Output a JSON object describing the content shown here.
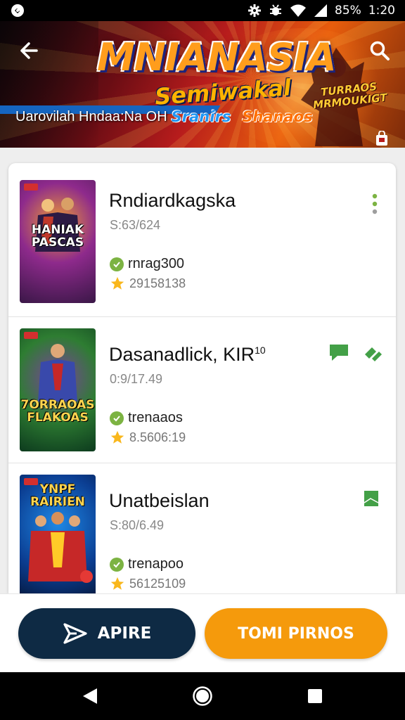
{
  "status_bar": {
    "battery": "85%",
    "time": "1:20",
    "icons": [
      "app-notification-icon",
      "settings-icon",
      "bug-icon",
      "wifi-icon",
      "signal-icon"
    ]
  },
  "banner": {
    "title": "MNIANASIA",
    "subtitle": "Semiwakal",
    "tagline_plain": "Uarovilah Hndaa:Na OH",
    "tagline_blue": "Sranirs",
    "tagline_orange": "Shanaos",
    "badge": "TURRAOS MRMOUKIGT",
    "back_icon": "arrow-left-icon",
    "search_icon": "search-icon",
    "cart_icon": "shopping-bag-icon"
  },
  "items": [
    {
      "title": "Rndiardkagska",
      "subtitle": "S:63/624",
      "tag": "rnrag300",
      "rating": "29158138",
      "cover_text": "HANIAK PASCAS",
      "action_icon": "more-vert-icon",
      "cover_colors": [
        "#3a1747",
        "#8e2a8c",
        "#f0a030"
      ]
    },
    {
      "title": "Dasanadlick, KIR",
      "title_sup": "10",
      "subtitle": "0:9/17.49",
      "tag": "trenaaos",
      "rating": "8.5606:19",
      "cover_text": "7ORRAOAS FLAKOAS",
      "action_icon": "chat-bubble-icon",
      "action_icon_2": "edit-icon",
      "cover_colors": [
        "#0d3b1e",
        "#2e7d32",
        "#7e3fa0"
      ]
    },
    {
      "title": "Unatbeislan",
      "subtitle": "S:80/6.49",
      "tag": "trenapoo",
      "rating": "56125109",
      "cover_text": "YNPF RAIRIEN",
      "action_icon": "bookmark-icon",
      "cover_colors": [
        "#0b3d91",
        "#1e88e5",
        "#c62828"
      ]
    }
  ],
  "buttons": {
    "primary_label": "APIRE",
    "primary_icon": "send-icon",
    "secondary_label": "TOMI PIRNOS"
  },
  "nav": {
    "back_icon": "nav-back-icon",
    "home_icon": "nav-home-icon",
    "recents_icon": "nav-recents-icon"
  },
  "colors": {
    "accent_green": "#7cb342",
    "primary_button": "#0e2a44",
    "secondary_button": "#f59a0c",
    "star": "#f9b71c"
  }
}
